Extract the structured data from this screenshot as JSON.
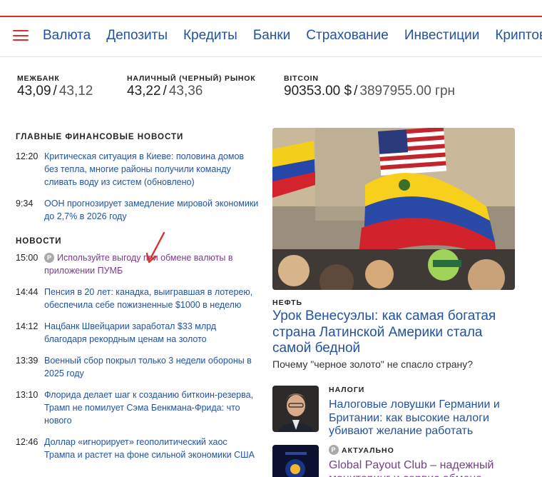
{
  "nav": {
    "menu_icon": "hamburger-menu-icon",
    "items": [
      "Валюта",
      "Депозиты",
      "Кредиты",
      "Банки",
      "Страхование",
      "Инвестиции",
      "Криптовалюта"
    ]
  },
  "rates": [
    {
      "title": "Межбанк",
      "first": "43,09",
      "second": "43,12"
    },
    {
      "title": "Наличный (черный) рынок",
      "first": "43,22",
      "second": "43,36"
    },
    {
      "title": "Bitcoin",
      "first": "90353.00 $",
      "second": "3897955.00 грн"
    }
  ],
  "main_news": {
    "title": "Главные финансовые новости",
    "items": [
      {
        "time": "12:20",
        "text": "Критическая ситуация в Киеве: половина домов без тепла, многие районы получили команду сливать воду из систем (обновлено)"
      },
      {
        "time": "9:34",
        "text": "ООН прогнозирует замедление мировой экономики до 2,7% в 2026 году"
      }
    ]
  },
  "news": {
    "title": "Новости",
    "items": [
      {
        "time": "15:00",
        "badge": "P",
        "promo": true,
        "text": "Используйте выгоду при обмене валюты в приложении ПУМБ"
      },
      {
        "time": "14:44",
        "text": "Пенсия в 20 лет: канадка, выигравшая в лотерею, обеспечила себе пожизненные $1000 в неделю"
      },
      {
        "time": "14:12",
        "text": "Нацбанк Швейцарии заработал $33 млрд благодаря рекордным ценам на золото"
      },
      {
        "time": "13:39",
        "text": "Военный сбор покрыл только 3 недели обороны в 2025 году"
      },
      {
        "time": "13:10",
        "text": "Флорида делает шаг к созданию биткоин-резерва, Трамп не помилует Сэма Бенкмана-Фрида: что нового"
      },
      {
        "time": "12:46",
        "text": "Доллар «игнорирует» геополитический хаос Трампа и растет на фоне сильной экономики США"
      }
    ]
  },
  "hero": {
    "tag": "Нефть",
    "title": "Урок Венесуэлы: как самая богатая страна Латинской Америки стала самой бедной",
    "subtitle": "Почему \"черное золото\" не спасло страну?"
  },
  "cards": [
    {
      "tag": "Налоги",
      "title": "Налоговые ловушки Германии и Британии: как высокие налоги убивают желание работать"
    },
    {
      "tag": "Актуально",
      "badge": "P",
      "promo": true,
      "title": "Global Payout Club – надежный мониторинг и сервис обмена"
    }
  ],
  "colors": {
    "accent": "#d9302c",
    "link": "#2353a0",
    "promo": "#7b3c8c"
  }
}
